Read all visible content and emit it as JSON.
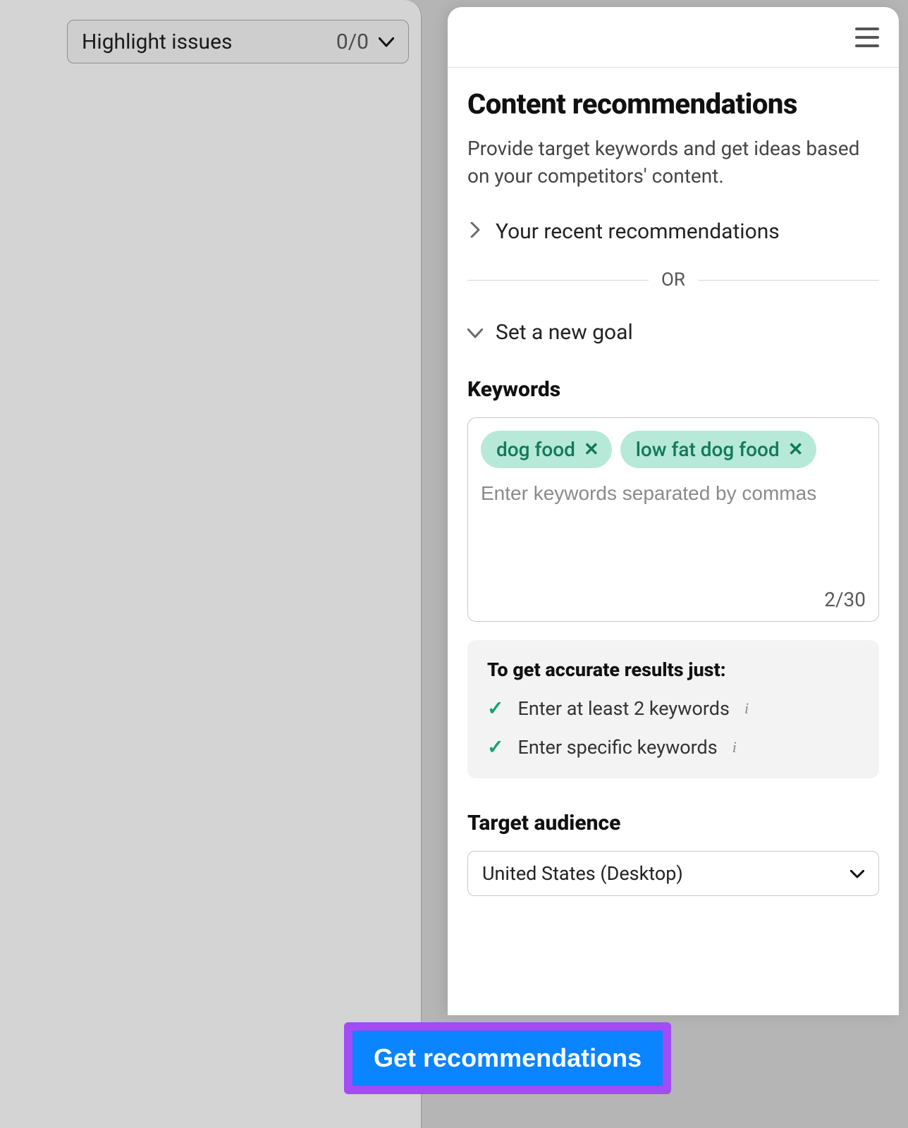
{
  "left": {
    "highlight_label": "Highlight issues",
    "highlight_count": "0/0"
  },
  "panel": {
    "title": "Content recommendations",
    "subtitle": "Provide target keywords and get ideas based on your competitors' content.",
    "recent_label": "Your recent recommendations",
    "or": "OR",
    "new_goal_label": "Set a new goal",
    "keywords_heading": "Keywords",
    "keywords": [
      "dog food",
      "low fat dog food"
    ],
    "kw_placeholder": "Enter keywords separated by commas",
    "kw_counter": "2/30",
    "tips": {
      "title": "To get accurate results just:",
      "items": [
        "Enter at least 2 keywords",
        "Enter specific keywords"
      ]
    },
    "target_heading": "Target audience",
    "target_value": "United States (Desktop)",
    "cta": "Get recommendations"
  }
}
